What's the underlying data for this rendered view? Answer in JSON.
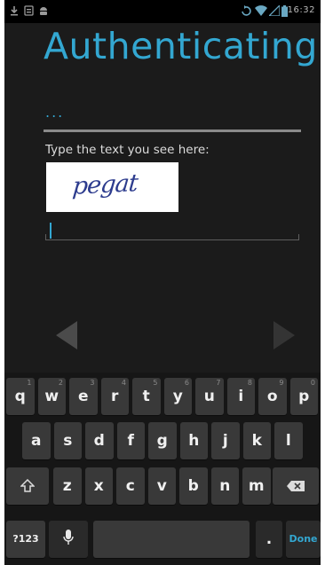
{
  "status_bar": {
    "time": "16:32",
    "left_icons": [
      "download-icon",
      "notification-icon",
      "android-icon"
    ],
    "right_icons": [
      "sync-icon",
      "wifi-icon",
      "signal-icon",
      "battery-icon"
    ]
  },
  "main": {
    "title": "Authenticating",
    "progress_dots": "...",
    "captcha_prompt": "Type the text you see here:",
    "captcha_text": "pegat",
    "answer_value": "",
    "accent_color": "#33a7d1"
  },
  "navigation": {
    "prev_icon": "arrow-left-icon",
    "next_icon": "arrow-right-icon"
  },
  "keyboard": {
    "row1": [
      {
        "label": "q",
        "hint": "1"
      },
      {
        "label": "w",
        "hint": "2"
      },
      {
        "label": "e",
        "hint": "3"
      },
      {
        "label": "r",
        "hint": "4"
      },
      {
        "label": "t",
        "hint": "5"
      },
      {
        "label": "y",
        "hint": "6"
      },
      {
        "label": "u",
        "hint": "7"
      },
      {
        "label": "i",
        "hint": "8"
      },
      {
        "label": "o",
        "hint": "9"
      },
      {
        "label": "p",
        "hint": "0"
      }
    ],
    "row2": [
      "a",
      "s",
      "d",
      "f",
      "g",
      "h",
      "j",
      "k",
      "l"
    ],
    "row3": [
      "z",
      "x",
      "c",
      "v",
      "b",
      "n",
      "m"
    ],
    "symbols_label": "?123",
    "period_label": ".",
    "done_label": "Done",
    "shift_icon": "shift-icon",
    "delete_icon": "backspace-icon",
    "mic_icon": "microphone-icon"
  }
}
